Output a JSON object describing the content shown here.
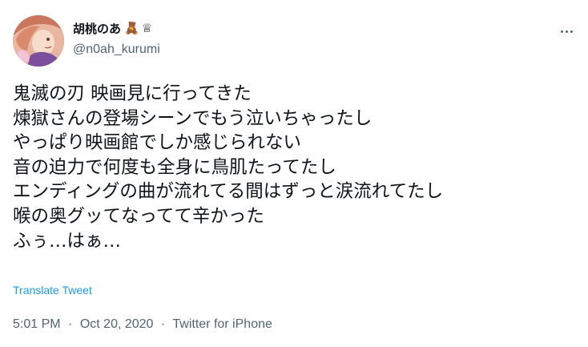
{
  "author": {
    "display_name": "胡桃のあ",
    "badges": [
      "🧸",
      "♕"
    ],
    "handle": "@n0ah_kurumi",
    "avatar_icon": "avatar-image"
  },
  "more_icon": "more-horizontal-icon",
  "tweet": {
    "lines": [
      "鬼滅の刃 映画見に行ってきた",
      "煉獄さんの登場シーンでもう泣いちゃったし",
      "やっぱり映画館でしか感じられない",
      "音の迫力で何度も全身に鳥肌たってたし",
      "エンディングの曲が流れてる間はずっと涙流れてたし",
      "喉の奥グッてなってて辛かった",
      "ふぅ…はぁ…"
    ]
  },
  "translate_label": "Translate Tweet",
  "meta": {
    "time": "5:01 PM",
    "separator": "·",
    "date": "Oct 20, 2020",
    "source": "Twitter for iPhone"
  },
  "colors": {
    "text": "#0f1419",
    "secondary": "#536471",
    "link": "#1d9bf0"
  }
}
